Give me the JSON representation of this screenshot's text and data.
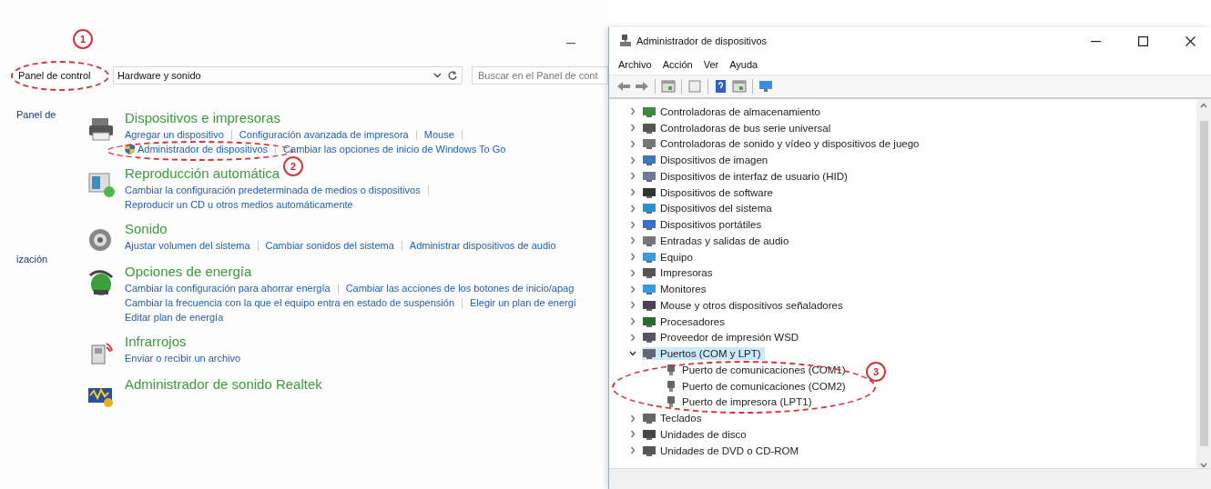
{
  "control_panel": {
    "breadcrumb": "Panel de control",
    "address": "Hardware y sonido",
    "search": {
      "placeholder": "Buscar en el Panel de cont"
    },
    "sidebar": [
      {
        "label": "Panel de"
      },
      {
        "label": "ización"
      }
    ],
    "categories": [
      {
        "title": "Dispositivos e impresoras",
        "lines": [
          {
            "links": [
              {
                "text": "Agregar un dispositivo"
              },
              {
                "text": "Configuración avanzada de impresora"
              },
              {
                "text": "Mouse"
              }
            ],
            "trailing_separator": true
          },
          {
            "links": [
              {
                "text": "Administrador de dispositivos",
                "shield": true
              },
              {
                "text": "Cambiar las opciones de inicio de Windows To Go"
              }
            ],
            "trailing_separator": false
          }
        ]
      },
      {
        "title": "Reproducción automática",
        "lines": [
          {
            "links": [
              {
                "text": "Cambiar la configuración predeterminada de medios o dispositivos"
              }
            ],
            "trailing_separator": true
          },
          {
            "links": [
              {
                "text": "Reproducir un CD u otros medios automáticamente"
              }
            ],
            "trailing_separator": false
          }
        ]
      },
      {
        "title": "Sonido",
        "lines": [
          {
            "links": [
              {
                "text": "Ajustar volumen del sistema"
              },
              {
                "text": "Cambiar sonidos del sistema"
              },
              {
                "text": "Administrar dispositivos de audio"
              }
            ],
            "trailing_separator": false
          }
        ]
      },
      {
        "title": "Opciones de energía",
        "lines": [
          {
            "links": [
              {
                "text": "Cambiar la configuración para ahorrar energía"
              },
              {
                "text": "Cambiar las acciones de los botones de inicio/apag"
              }
            ],
            "trailing_separator": false
          },
          {
            "links": [
              {
                "text": "Cambiar la frecuencia con la que el equipo entra en estado de suspensión"
              },
              {
                "text": "Elegir un plan de energí"
              }
            ],
            "trailing_separator": false
          },
          {
            "links": [
              {
                "text": "Editar plan de energía"
              }
            ],
            "trailing_separator": false
          }
        ]
      },
      {
        "title": "Infrarrojos",
        "lines": [
          {
            "links": [
              {
                "text": "Enviar o recibir un archivo"
              }
            ],
            "trailing_separator": false
          }
        ]
      },
      {
        "title": "Administrador de sonido Realtek"
      }
    ]
  },
  "device_manager": {
    "window": {
      "title": "Administrador de dispositivos"
    },
    "menu": [
      {
        "label": "Archivo"
      },
      {
        "label": "Acción"
      },
      {
        "label": "Ver"
      },
      {
        "label": "Ayuda"
      }
    ],
    "tree": [
      {
        "label": "Controladoras de almacenamiento",
        "expanded": false,
        "selected": false
      },
      {
        "label": "Controladoras de bus serie universal",
        "expanded": false,
        "selected": false
      },
      {
        "label": "Controladoras de sonido y vídeo y dispositivos de juego",
        "expanded": false,
        "selected": false
      },
      {
        "label": "Dispositivos de imagen",
        "expanded": false,
        "selected": false
      },
      {
        "label": "Dispositivos de interfaz de usuario (HID)",
        "expanded": false,
        "selected": false
      },
      {
        "label": "Dispositivos de software",
        "expanded": false,
        "selected": false
      },
      {
        "label": "Dispositivos del sistema",
        "expanded": false,
        "selected": false
      },
      {
        "label": "Dispositivos portátiles",
        "expanded": false,
        "selected": false
      },
      {
        "label": "Entradas y salidas de audio",
        "expanded": false,
        "selected": false
      },
      {
        "label": "Equipo",
        "expanded": false,
        "selected": false
      },
      {
        "label": "Impresoras",
        "expanded": false,
        "selected": false
      },
      {
        "label": "Monitores",
        "expanded": false,
        "selected": false
      },
      {
        "label": "Mouse y otros dispositivos señaladores",
        "expanded": false,
        "selected": false
      },
      {
        "label": "Procesadores",
        "expanded": false,
        "selected": false
      },
      {
        "label": "Proveedor de impresión WSD",
        "expanded": false,
        "selected": false
      },
      {
        "label": "Puertos (COM y LPT)",
        "expanded": true,
        "selected": true,
        "children": [
          {
            "label": "Puerto de comunicaciones (COM1)",
            "selected": false
          },
          {
            "label": "Puerto de comunicaciones (COM2)",
            "selected": false
          },
          {
            "label": "Puerto de impresora (LPT1)",
            "selected": false
          }
        ]
      },
      {
        "label": "Teclados",
        "expanded": false,
        "selected": false
      },
      {
        "label": "Unidades de disco",
        "expanded": false,
        "selected": false
      },
      {
        "label": "Unidades de DVD o CD-ROM",
        "expanded": false,
        "selected": false
      }
    ]
  },
  "annotations": [
    {
      "number": "1"
    },
    {
      "number": "2"
    },
    {
      "number": "3"
    }
  ]
}
